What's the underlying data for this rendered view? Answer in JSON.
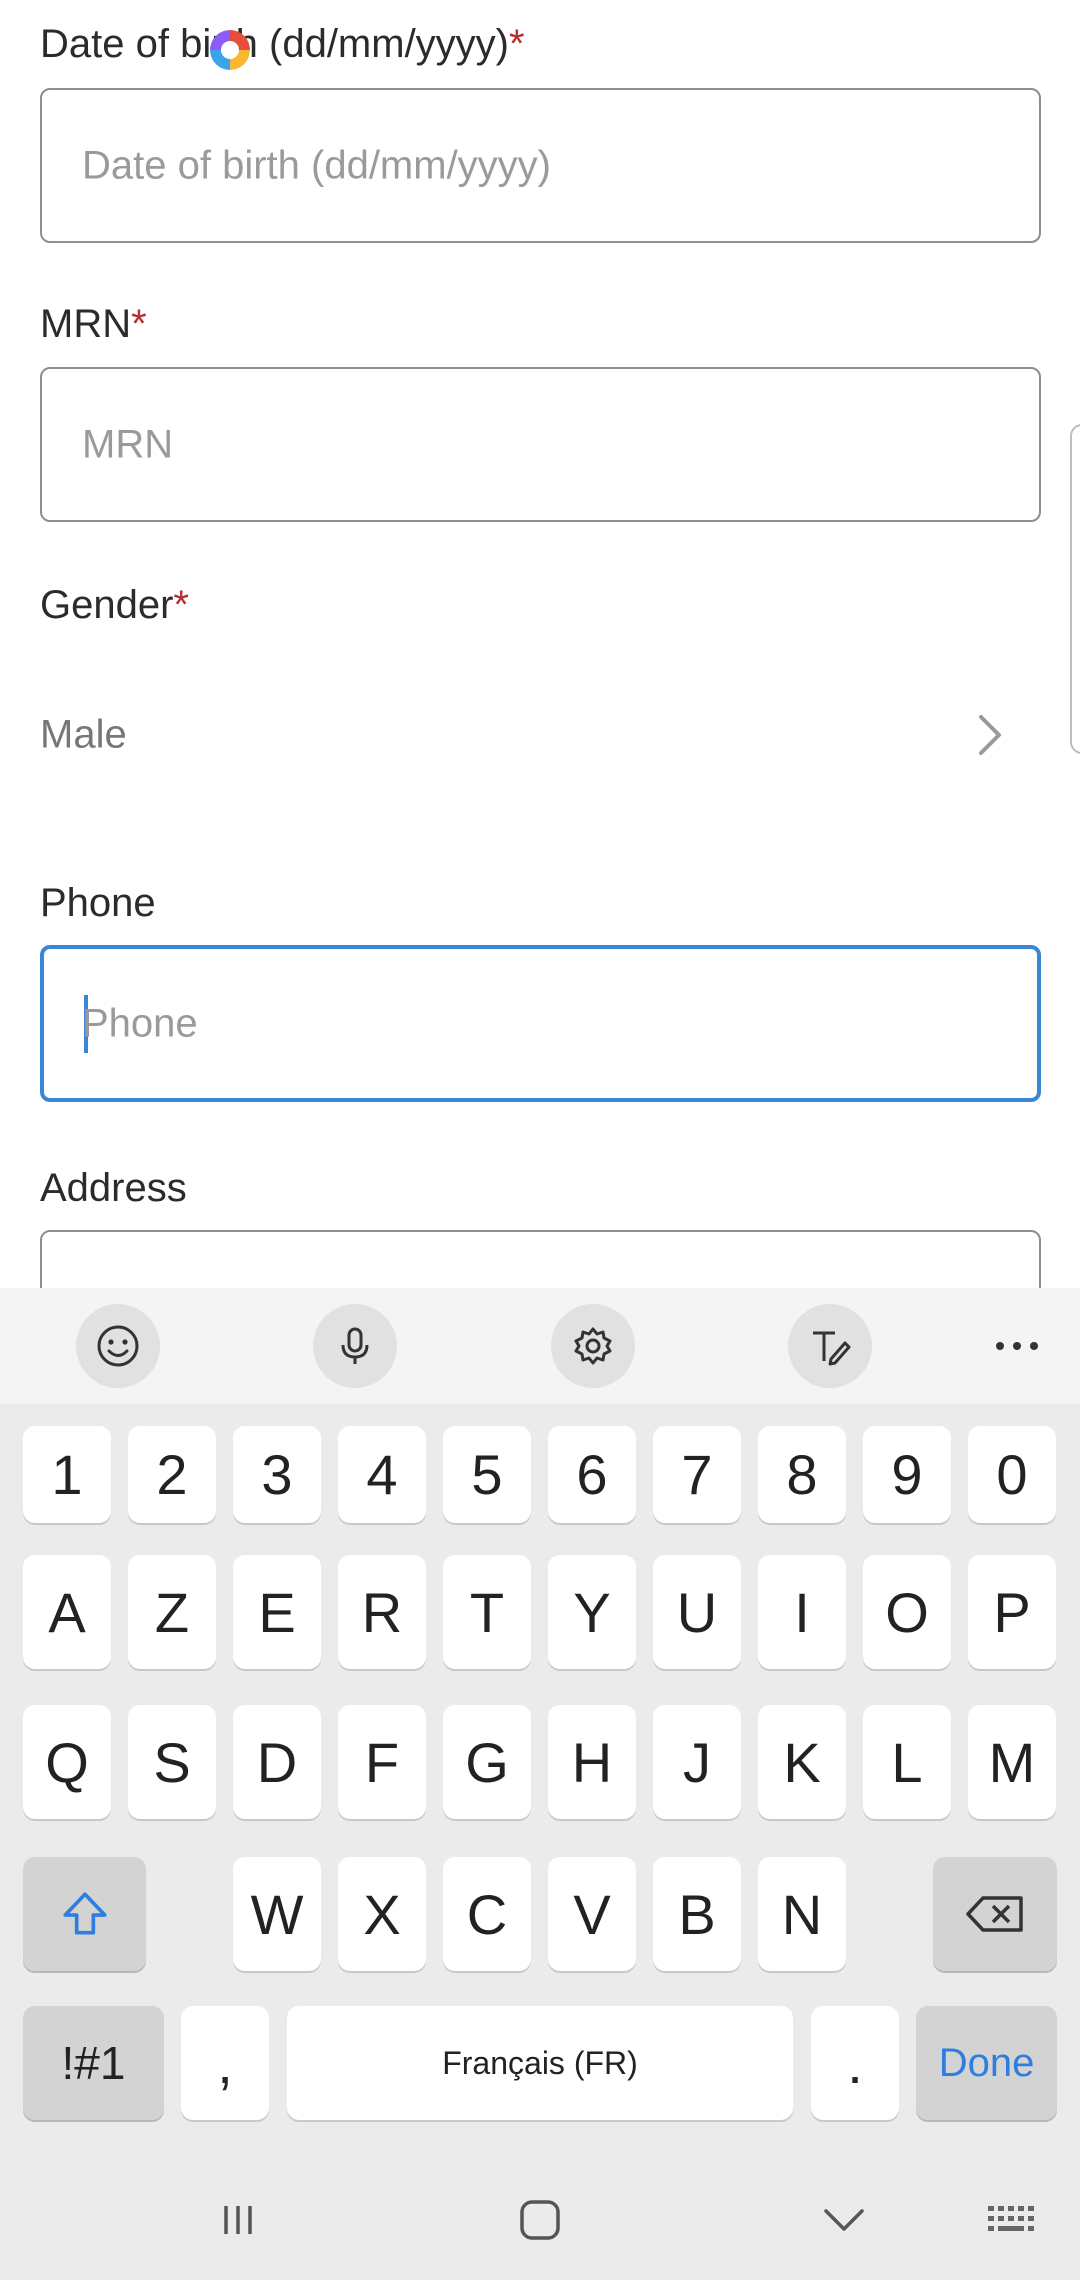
{
  "form": {
    "dob": {
      "label": "Date of birth (dd/mm/yyyy)",
      "required_mark": "*",
      "placeholder": "Date of birth (dd/mm/yyyy)",
      "value": ""
    },
    "mrn": {
      "label": "MRN",
      "required_mark": "*",
      "placeholder": "MRN",
      "value": ""
    },
    "gender": {
      "label": "Gender",
      "required_mark": "*",
      "selected": "Male"
    },
    "phone": {
      "label": "Phone",
      "placeholder": "Phone",
      "value": "",
      "focused": true
    },
    "address": {
      "label": "Address",
      "placeholder": "",
      "value": ""
    }
  },
  "keyboard": {
    "toolbar": [
      "emoji-icon",
      "microphone-icon",
      "settings-icon",
      "handwriting-icon",
      "more-icon"
    ],
    "number_row": [
      "1",
      "2",
      "3",
      "4",
      "5",
      "6",
      "7",
      "8",
      "9",
      "0"
    ],
    "row1": [
      "A",
      "Z",
      "E",
      "R",
      "T",
      "Y",
      "U",
      "I",
      "O",
      "P"
    ],
    "row2": [
      "Q",
      "S",
      "D",
      "F",
      "G",
      "H",
      "J",
      "K",
      "L",
      "M"
    ],
    "row3": [
      "W",
      "X",
      "C",
      "V",
      "B",
      "N"
    ],
    "symbols_label": "!#1",
    "comma_label": ",",
    "space_label": "Français (FR)",
    "period_label": ".",
    "done_label": "Done"
  },
  "navbar": [
    "recent-apps-icon",
    "home-icon",
    "back-chevron-icon",
    "keyboard-switch-icon"
  ],
  "colors": {
    "accent": "#3a86d6",
    "required": "#b23030",
    "done_text": "#2f7de1",
    "keyboard_bg": "#ebebeb"
  }
}
